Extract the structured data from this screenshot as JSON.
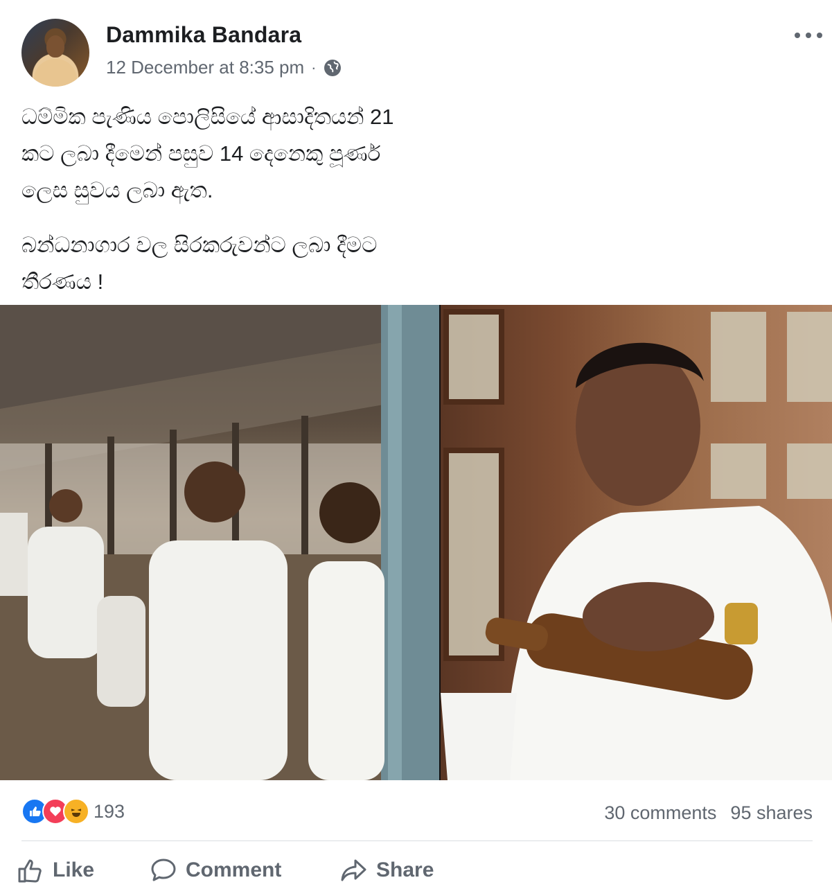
{
  "post": {
    "author": "Dammika Bandara",
    "timestamp": "12 December at 8:35 pm",
    "separator": "·",
    "privacy_icon": "globe-icon",
    "menu_icon": "more-options-icon",
    "text_lines_p1": [
      "ධම්මික පැණිය පොලිසියේ ආසාදිතයන් 21",
      "කට ලබා දීමෙන් පසුව 14 දෙනෙකු පූර්ණ",
      "ලෙස සුවය ලබා ඇත."
    ],
    "text_lines_p2": [
      "බන්ධනාගාර වල සිරකරුවන්ට ලබා දීමට",
      "තීරණය !"
    ]
  },
  "engagement": {
    "reactions_count": "193",
    "reaction_icons": [
      "like-icon",
      "love-icon",
      "haha-icon"
    ],
    "comments": "30 comments",
    "shares": "95 shares"
  },
  "actions": {
    "like_label": "Like",
    "comment_label": "Comment",
    "share_label": "Share"
  },
  "colors": {
    "author_text": "#1c1e21",
    "secondary_text": "#606770",
    "like_blue": "#1877f2",
    "love_red": "#f33e58",
    "haha_yellow": "#f7b125",
    "divider": "#dadde1"
  }
}
